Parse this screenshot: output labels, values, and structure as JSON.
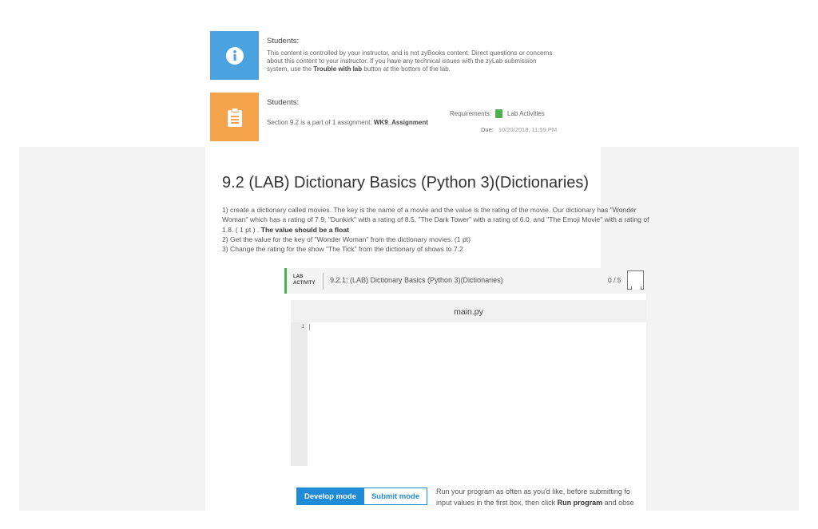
{
  "notice_info": {
    "title": "Students:",
    "line1": "This content is controlled by your instructor, and is not zyBooks content. Direct questions or concerns",
    "line2": "about this content to your instructor. If you have any technical issues with the zyLab submission",
    "line3_pre": "system, use the ",
    "line3_bold": "Trouble with lab",
    "line3_post": " button at the bottom of the lab.",
    "icon": "info-icon",
    "color": "#4aa3df"
  },
  "notice_assign": {
    "title": "Students:",
    "text_pre": "Section 9.2 is a part of 1 assignment: ",
    "assignment": "WK9_Assignment",
    "requirements_label": "Requirements:",
    "requirements_value": "Lab Activities",
    "due_label": "Due:",
    "due_value": "10/20/2018, 11:59 PM",
    "icon": "clipboard-icon",
    "color": "#f5a34b"
  },
  "section": {
    "title": "9.2 (LAB) Dictionary Basics (Python 3)(Dictionaries)",
    "line1": "1) create a dictionary called movies. The key is the name of a movie and the value is the rating of the movie. Our dictionary has \"Wonder",
    "line2": "Woman\" which has a rating of 7.9, \"Dunkirk\" with a rating of 8.5, \"The Dark Tower\" with a rating of 6.0, and \"The Emoji Movie\" with a rating of",
    "line3_pre": "1.8. ( 1 pt ) . ",
    "line3_bold": "The value should be a float",
    "line4": "2) Get the value for the key of \"Wonder Woman\" from the dictionary movies. (1 pt)",
    "line5": "3) Change the rating for the show \"The Tick\" from the dictionary of shows to 7.2"
  },
  "lab": {
    "tag_line1": "LAB",
    "tag_line2": "ACTIVITY",
    "title": "9.2.1: (LAB) Dictionary Basics (Python 3)(Dictionaries)",
    "score": "0 / 5",
    "file_name": "main.py",
    "line_number": "1",
    "develop_mode": "Develop mode",
    "submit_mode": "Submit mode",
    "run_note_line1": "Run your program as often as you'd like, before submitting fo",
    "run_note_line2_pre": "input values in the first box, then click ",
    "run_note_line2_bold": "Run program",
    "run_note_line2_post": " and obse",
    "accent": "#4caf50",
    "button_color": "#1f8ad6"
  }
}
